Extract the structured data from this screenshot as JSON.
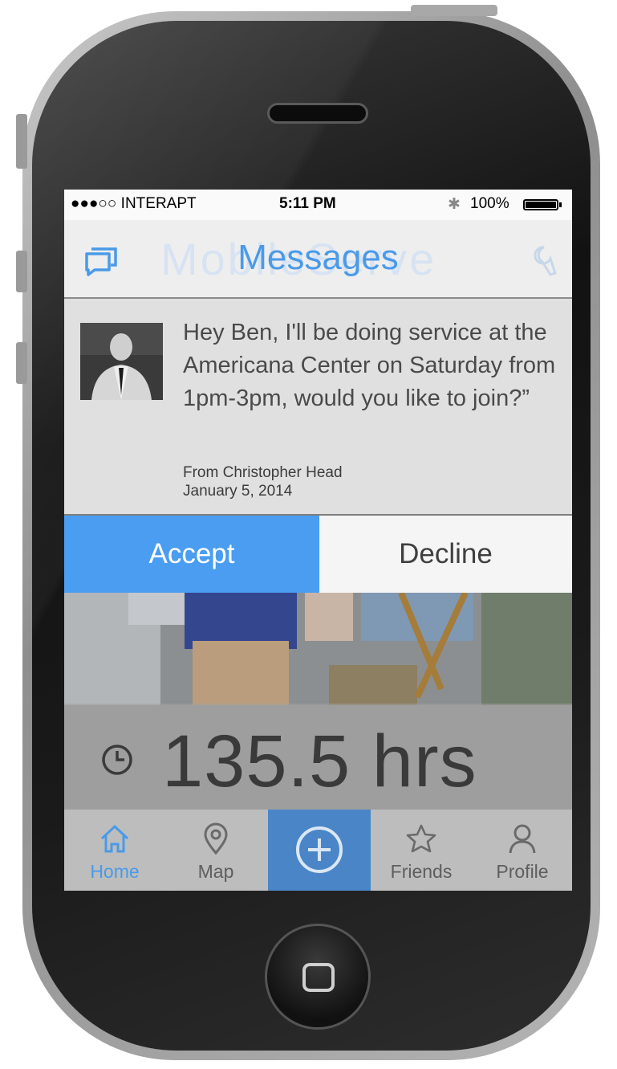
{
  "status_bar": {
    "carrier": "●●●○○ INTERAPT",
    "time": "5:11 PM",
    "battery": "100%",
    "bluetooth_icon": "bluetooth-icon",
    "battery_icon": "battery-icon"
  },
  "nav": {
    "title": "Messages",
    "background_logo_text": "MobileServe",
    "left_icon": "chat-bubble-icon",
    "right_icon": "wrench-icon",
    "title_color": "#4a9ae8"
  },
  "message": {
    "text": "Hey Ben, I'll be doing service at the Americana Center on Saturday from 1pm-3pm, would you like to join?”",
    "from": "From Christopher Head",
    "date": "January 5, 2014"
  },
  "actions": {
    "accept_label": "Accept",
    "decline_label": "Decline",
    "accept_color": "#4a9df0"
  },
  "stats": {
    "hours": "135.5 hrs",
    "icon": "clock-icon"
  },
  "tabs": [
    {
      "label": "Home",
      "icon": "home-icon"
    },
    {
      "label": "Map",
      "icon": "map-pin-icon"
    },
    {
      "label": "",
      "icon": "plus-circle-icon"
    },
    {
      "label": "Friends",
      "icon": "star-icon"
    },
    {
      "label": "Profile",
      "icon": "person-icon"
    }
  ]
}
